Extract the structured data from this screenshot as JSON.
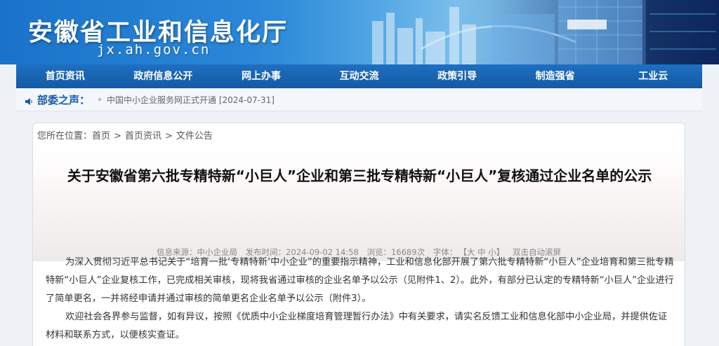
{
  "header": {
    "site_title": "安徽省工业和信息化厅",
    "site_domain": "jx.ah.gov.cn"
  },
  "nav": {
    "items": [
      "首页资讯",
      "政府信息公开",
      "网上办事",
      "互动交流",
      "政策引导",
      "制造强省",
      "工业云"
    ]
  },
  "notice": {
    "title": "部委之声：",
    "text": "中国中小企业服务网正式开通 [2024-07-31]"
  },
  "breadcrumb": {
    "prefix": "您所在位置：",
    "items": [
      "首页",
      "首页资讯",
      "文件公告"
    ],
    "sep": ">"
  },
  "article": {
    "title": "关于安徽省第六批专精特新“小巨人”企业和第三批专精特新“小巨人”复核通过企业名单的公示",
    "meta": {
      "source": "信息来源：中小企业局",
      "date": "发布时间：2024-09-02 14:58",
      "views": "浏览：16689次",
      "font_label": "字体：",
      "font_size": "【大 中 小】",
      "autoscroll": "双击自动滚屏"
    },
    "paragraphs": [
      "为深入贯彻习近平总书记关于“培育一批‘专精特新’中小企业”的重要指示精神，工业和信息化部开展了第六批专精特新“小巨人”企业培育和第三批专精特新“小巨人”企业复核工作，已完成相关审核，现将我省通过审核的企业名单予以公示（见附件1、2）。此外，有部分已认定的专精特新“小巨人”企业进行了简单更名，一并将经申请并通过审核的简单更名企业名单予以公示（附件3）。",
      "欢迎社会各界参与监督，如有异议，按照《优质中小企业梯度培育管理暂行办法》中有关要求，请实名反馈工业和信息化部中小企业局，并提供佐证材料和联系方式，以便核实查证。"
    ]
  },
  "colors": {
    "nav_bg": "#1a64b2",
    "notice_title": "#1a5aa6"
  }
}
